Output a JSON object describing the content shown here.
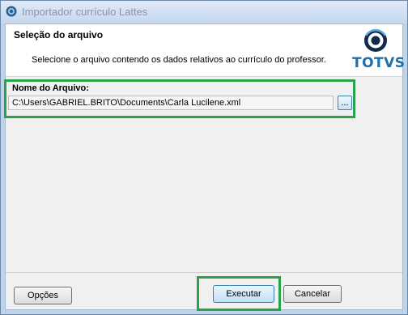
{
  "window": {
    "title": "Importador currículo Lattes"
  },
  "header": {
    "title": "Seleção do arquivo",
    "description": "Selecione o arquivo contendo os dados relativos ao currículo do professor."
  },
  "brand": {
    "logo_text": "TOTVS",
    "color": "#1f6fa8"
  },
  "file": {
    "label": "Nome do Arquivo:",
    "value": "C:\\Users\\GABRIEL.BRITO\\Documents\\Carla Lucilene.xml",
    "browse_label": "..."
  },
  "buttons": {
    "options_label": "Opções",
    "run_label": "Executar",
    "cancel_label": "Cancelar"
  },
  "highlight_color": "#2aa24a"
}
